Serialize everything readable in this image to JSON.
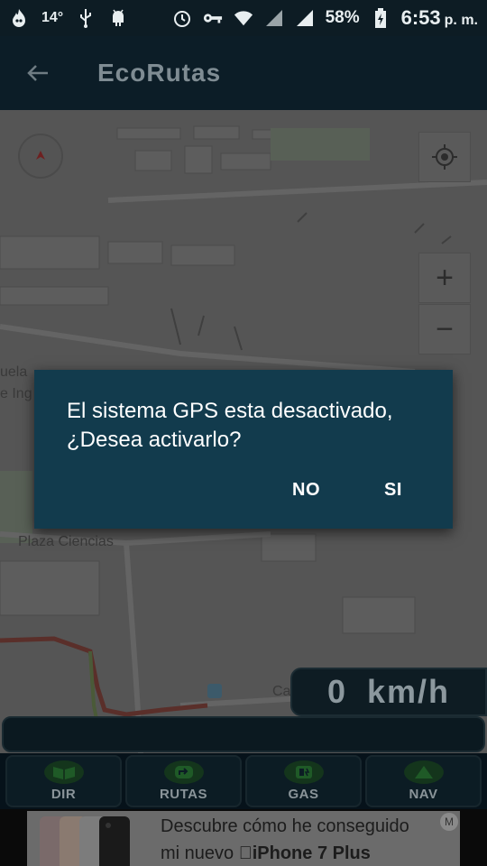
{
  "status_bar": {
    "temperature": "14°",
    "battery_percent": "58%",
    "time": "6:53",
    "ampm": "p. m.",
    "icons": [
      "flame-icon",
      "usb-icon",
      "android-icon",
      "alarm-icon",
      "key-icon",
      "wifi-icon",
      "signal-icon",
      "signal-icon",
      "battery-icon"
    ]
  },
  "app_bar": {
    "title": "EcoRutas",
    "back_icon": "arrow-left-icon"
  },
  "map": {
    "labels": {
      "uela_a": "uela",
      "uela_b": "e Ing",
      "plaza": "Plaza Ciencias",
      "ca": "Ca"
    },
    "controls": {
      "compass_icon": "compass-icon",
      "locate_icon": "crosshair-icon",
      "zoom_in": "+",
      "zoom_out": "−"
    }
  },
  "dialog": {
    "message": "El sistema GPS esta desactivado, ¿Desea activarlo?",
    "no_label": "NO",
    "yes_label": "SI"
  },
  "speed": {
    "value": "0",
    "unit": "km/h"
  },
  "bottom_nav": [
    {
      "label": "DIR",
      "icon": "book-icon"
    },
    {
      "label": "RUTAS",
      "icon": "route-arrow-icon"
    },
    {
      "label": "GAS",
      "icon": "fuel-icon"
    },
    {
      "label": "NAV",
      "icon": "navigate-icon"
    }
  ],
  "ad": {
    "line1": "Descubre cómo he conseguido",
    "line2_prefix": "mi nuevo ",
    "line2_brand": "iPhone 7 Plus",
    "mark": "M"
  },
  "colors": {
    "app_bar_bg": "#0c1d27",
    "dialog_bg": "#123b4d",
    "nav_icon_green": "#2e7d32",
    "map_dimmed": "#565656"
  }
}
